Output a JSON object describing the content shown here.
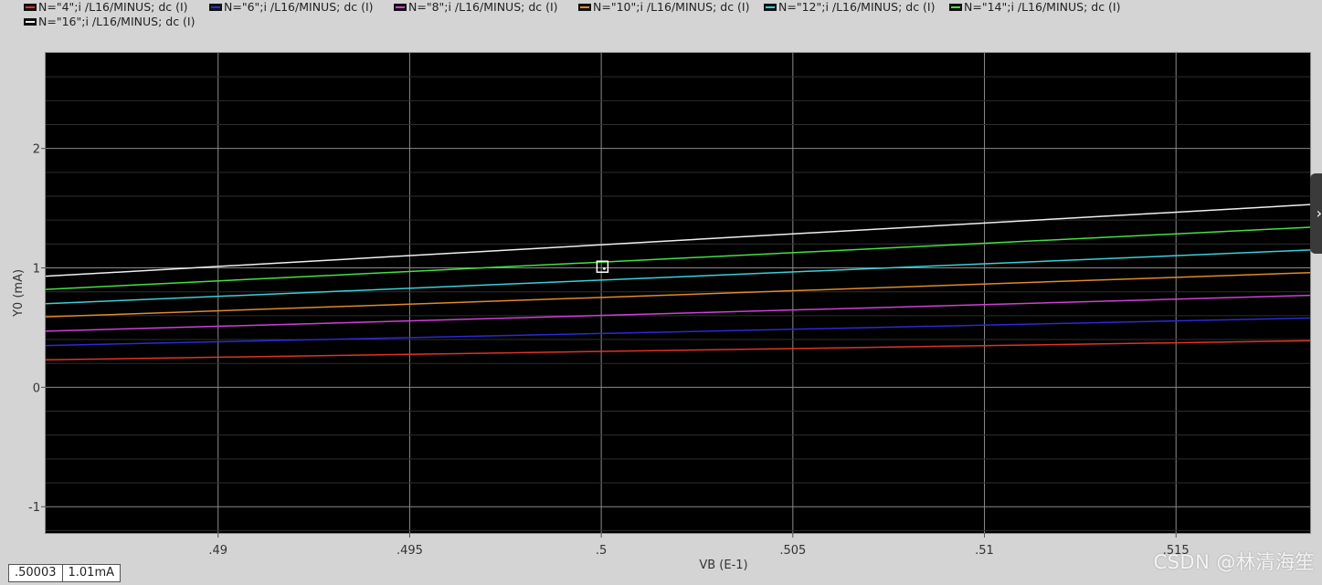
{
  "chart_data": {
    "type": "line",
    "xlabel": "VB (E-1)",
    "ylabel": "Y0 (mA)",
    "xlim": [
      0.4855,
      0.5185
    ],
    "ylim": [
      -1.22,
      2.8
    ],
    "x_ticks": [
      0.49,
      0.495,
      0.5,
      0.505,
      0.51,
      0.515
    ],
    "x_tick_labels": [
      ".49",
      ".495",
      ".5",
      ".505",
      ".51",
      ".515"
    ],
    "y_ticks": [
      -1,
      0,
      1,
      2
    ],
    "y_tick_labels": [
      "-1",
      "0",
      "1",
      "2"
    ],
    "grid": true,
    "background": "#000000",
    "x": [
      0.4855,
      0.5185
    ],
    "series": [
      {
        "name": "N=\"4\";i /L16/MINUS; dc (I)",
        "color": "#e0322b",
        "values": [
          0.23,
          0.39
        ]
      },
      {
        "name": "N=\"6\";i /L16/MINUS; dc (I)",
        "color": "#2a2ad8",
        "values": [
          0.35,
          0.58
        ]
      },
      {
        "name": "N=\"8\";i /L16/MINUS; dc (I)",
        "color": "#d040d8",
        "values": [
          0.47,
          0.77
        ]
      },
      {
        "name": "N=\"10\";i /L16/MINUS; dc (I)",
        "color": "#e08a2a",
        "values": [
          0.59,
          0.96
        ]
      },
      {
        "name": "N=\"12\";i /L16/MINUS; dc (I)",
        "color": "#3ad0d8",
        "values": [
          0.7,
          1.15
        ]
      },
      {
        "name": "N=\"14\";i /L16/MINUS; dc (I)",
        "color": "#44e044",
        "values": [
          0.82,
          1.34
        ]
      },
      {
        "name": "N=\"16\";i /L16/MINUS; dc (I)",
        "color": "#f0f0f0",
        "values": [
          0.93,
          1.53
        ]
      }
    ],
    "marker": {
      "x": 0.50003,
      "y": 1.01
    }
  },
  "readout": {
    "x_value": ".50003",
    "y_value": "1.01mA"
  },
  "side_tab": {
    "icon": "chevron-right-icon",
    "glyph": "›"
  },
  "watermark": "CSDN @林清海笙"
}
